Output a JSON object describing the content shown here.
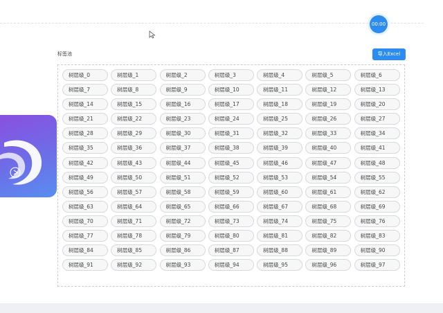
{
  "timer": {
    "label": "00:00"
  },
  "tag_pool": {
    "title": "标签池",
    "import_button": "导入Excel",
    "tags": [
      "树层级_0",
      "树层级_1",
      "树层级_2",
      "树层级_3",
      "树层级_4",
      "树层级_5",
      "树层级_6",
      "树层级_7",
      "树层级_8",
      "树层级_9",
      "树层级_10",
      "树层级_11",
      "树层级_12",
      "树层级_13",
      "树层级_14",
      "树层级_15",
      "树层级_16",
      "树层级_17",
      "树层级_18",
      "树层级_19",
      "树层级_20",
      "树层级_21",
      "树层级_22",
      "树层级_23",
      "树层级_24",
      "树层级_25",
      "树层级_26",
      "树层级_27",
      "树层级_28",
      "树层级_29",
      "树层级_30",
      "树层级_31",
      "树层级_32",
      "树层级_33",
      "树层级_34",
      "树层级_35",
      "树层级_36",
      "树层级_37",
      "树层级_38",
      "树层级_39",
      "树层级_40",
      "树层级_41",
      "树层级_42",
      "树层级_43",
      "树层级_44",
      "树层级_45",
      "树层级_46",
      "树层级_47",
      "树层级_48",
      "树层级_49",
      "树层级_50",
      "树层级_51",
      "树层级_52",
      "树层级_53",
      "树层级_54",
      "树层级_55",
      "树层级_56",
      "树层级_57",
      "树层级_58",
      "树层级_59",
      "树层级_60",
      "树层级_61",
      "树层级_62",
      "树层级_63",
      "树层级_64",
      "树层级_65",
      "树层级_66",
      "树层级_67",
      "树层级_68",
      "树层级_69",
      "树层级_70",
      "树层级_71",
      "树层级_72",
      "树层级_73",
      "树层级_74",
      "树层级_75",
      "树层级_76",
      "树层级_77",
      "树层级_78",
      "树层级_79",
      "树层级_80",
      "树层级_81",
      "树层级_82",
      "树层级_83",
      "树层级_84",
      "树层级_85",
      "树层级_86",
      "树层级_87",
      "树层级_88",
      "树层级_89",
      "树层级_90",
      "树层级_91",
      "树层级_92",
      "树层级_93",
      "树层级_94",
      "树层级_95",
      "树层级_96",
      "树层级_97"
    ]
  },
  "colors": {
    "primary": "#2d8cf0",
    "tag_background": "#f7f7f7",
    "tag_border": "#d6d9de"
  },
  "icons": {
    "cursor": "arrow-cursor-icon",
    "app_logo": "app-logo-icon"
  }
}
